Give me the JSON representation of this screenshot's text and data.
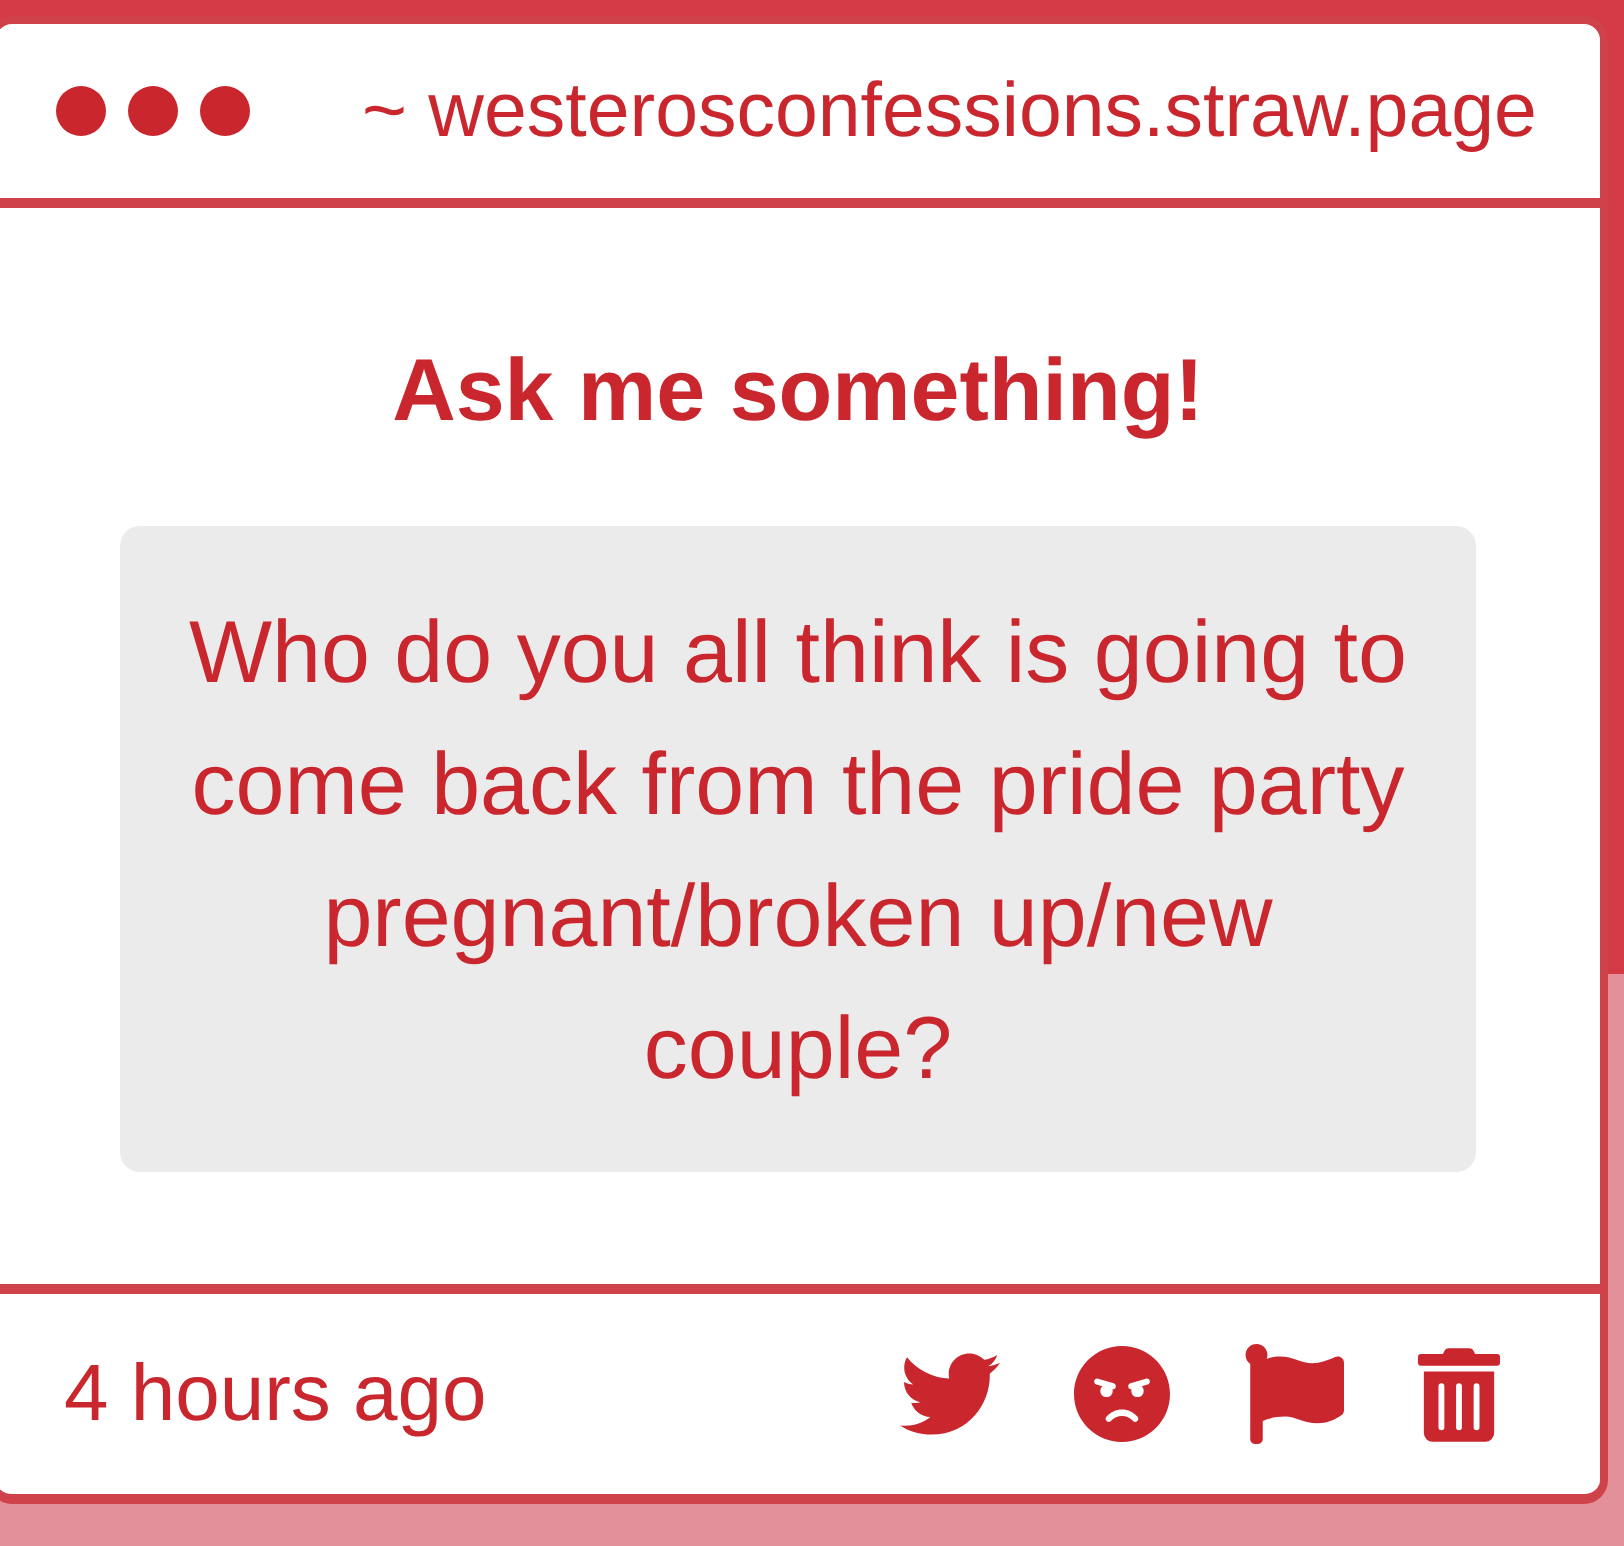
{
  "window": {
    "url": "~ westerosconfessions.straw.page"
  },
  "prompt": {
    "title": "Ask me something!"
  },
  "question": {
    "text": "Who do you all think is going to come back from the pride party pregnant/broken up/new couple?"
  },
  "footer": {
    "time": "4 hours ago",
    "actions": [
      {
        "kind": "twitter"
      },
      {
        "kind": "angry"
      },
      {
        "kind": "flag"
      },
      {
        "kind": "trash"
      }
    ]
  }
}
